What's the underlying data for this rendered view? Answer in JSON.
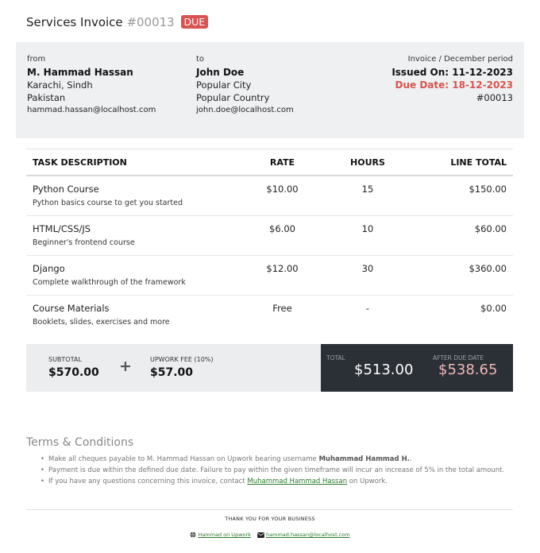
{
  "invoice": {
    "title": "Services Invoice",
    "number": "#00013",
    "status": "DUE"
  },
  "from": {
    "label": "from",
    "name": "M. Hammad Hassan",
    "city": "Karachi, Sindh",
    "country": "Pakistan",
    "email": "hammad.hassan@localhost.com"
  },
  "to": {
    "label": "to",
    "name": "John Doe",
    "city": "Popular City",
    "country": "Popular Country",
    "email": "john.doe@localhost.com"
  },
  "meta": {
    "period": "Invoice / December period",
    "issued": "Issued On: 11-12-2023",
    "due": "Due Date: 18-12-2023",
    "number": "#00013"
  },
  "table": {
    "headers": [
      "TASK DESCRIPTION",
      "RATE",
      "HOURS",
      "LINE TOTAL"
    ],
    "rows": [
      {
        "title": "Python Course",
        "desc": "Python basics course to get you started",
        "rate": "$10.00",
        "hours": "15",
        "total": "$150.00"
      },
      {
        "title": "HTML/CSS/JS",
        "desc": "Beginner's frontend course",
        "rate": "$6.00",
        "hours": "10",
        "total": "$60.00"
      },
      {
        "title": "Django",
        "desc": "Complete walkthrough of the framework",
        "rate": "$12.00",
        "hours": "30",
        "total": "$360.00"
      },
      {
        "title": "Course Materials",
        "desc": "Booklets, slides, exercises and more",
        "rate": "Free",
        "hours": "-",
        "total": "$0.00"
      }
    ]
  },
  "totals": {
    "subtotal_label": "SUBTOTAL",
    "subtotal": "$570.00",
    "plus": "+",
    "fee_label": "UPWORK FEE (10%)",
    "fee": "$57.00",
    "total_label": "TOTAL",
    "total": "$513.00",
    "after_label": "AFTER DUE DATE",
    "after": "$538.65"
  },
  "terms": {
    "title": "Terms & Conditions",
    "item1_pre": "Make all cheques payable to M. Hammad Hassan on Upwork bearing username ",
    "item1_bold": "Muhammad Hammad H.",
    "item1_post": ".",
    "item2": "Payment is due within the defined due date. Failure to pay within the given timeframe will incur an increase of 5% in the total amount.",
    "item3_pre": "If you have any questions concerning this invoice, contact ",
    "item3_link": "Muhammad Hammad Hassan",
    "item3_post": " on Upwork."
  },
  "footer": {
    "thanks": "THANK YOU FOR YOUR BUSINESS",
    "upwork_link": "Hammad on Upwork",
    "email_link": "hammad.hassan@localhost.com",
    "globe_icon": "globe-icon",
    "mail_icon": "envelope-icon"
  },
  "colors": {
    "due": "#d9534f",
    "dark_panel": "#2b2f36",
    "after_due": "#f0b8b8",
    "link": "#2a7a2a"
  }
}
